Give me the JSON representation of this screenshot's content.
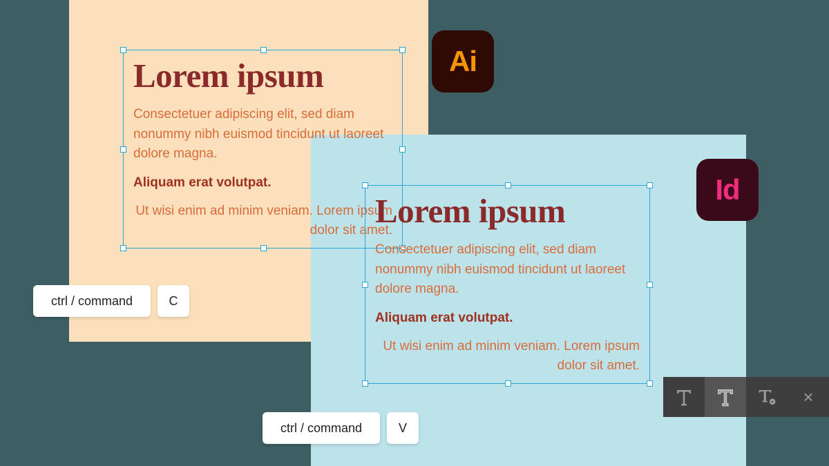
{
  "canvases": {
    "peach": {
      "heading": "Lorem ipsum",
      "paragraph": "Consectetuer adipiscing elit, sed diam nonummy nibh euismod tincidunt ut laoreet dolore magna.",
      "bold": "Aliquam erat volutpat.",
      "tail": "Ut wisi enim ad minim veniam. Lorem ipsum dolor sit amet."
    },
    "blue": {
      "heading": "Lorem ipsum",
      "paragraph": "Consectetuer adipiscing elit, sed diam nonummy nibh euismod tincidunt ut laoreet dolore magna.",
      "bold": "Aliquam erat volutpat.",
      "tail": "Ut wisi enim ad minim veniam. Lorem ipsum dolor sit amet."
    }
  },
  "shortcuts": {
    "copy": {
      "modifier": "ctrl / command",
      "key": "C"
    },
    "paste": {
      "modifier": "ctrl / command",
      "key": "V"
    }
  },
  "apps": {
    "illustrator": "Ai",
    "indesign": "Id"
  },
  "toolbar": {
    "tool1": "type-tool",
    "tool2": "type-on-path-tool",
    "tool3": "touch-type-tool",
    "close": "×"
  },
  "colors": {
    "background": "#3d5e63",
    "peach": "#fbe0bb",
    "blue": "#bce3ea",
    "selection": "#29a5d6",
    "heading": "#8a2a2a",
    "body": "#d96c3c"
  }
}
